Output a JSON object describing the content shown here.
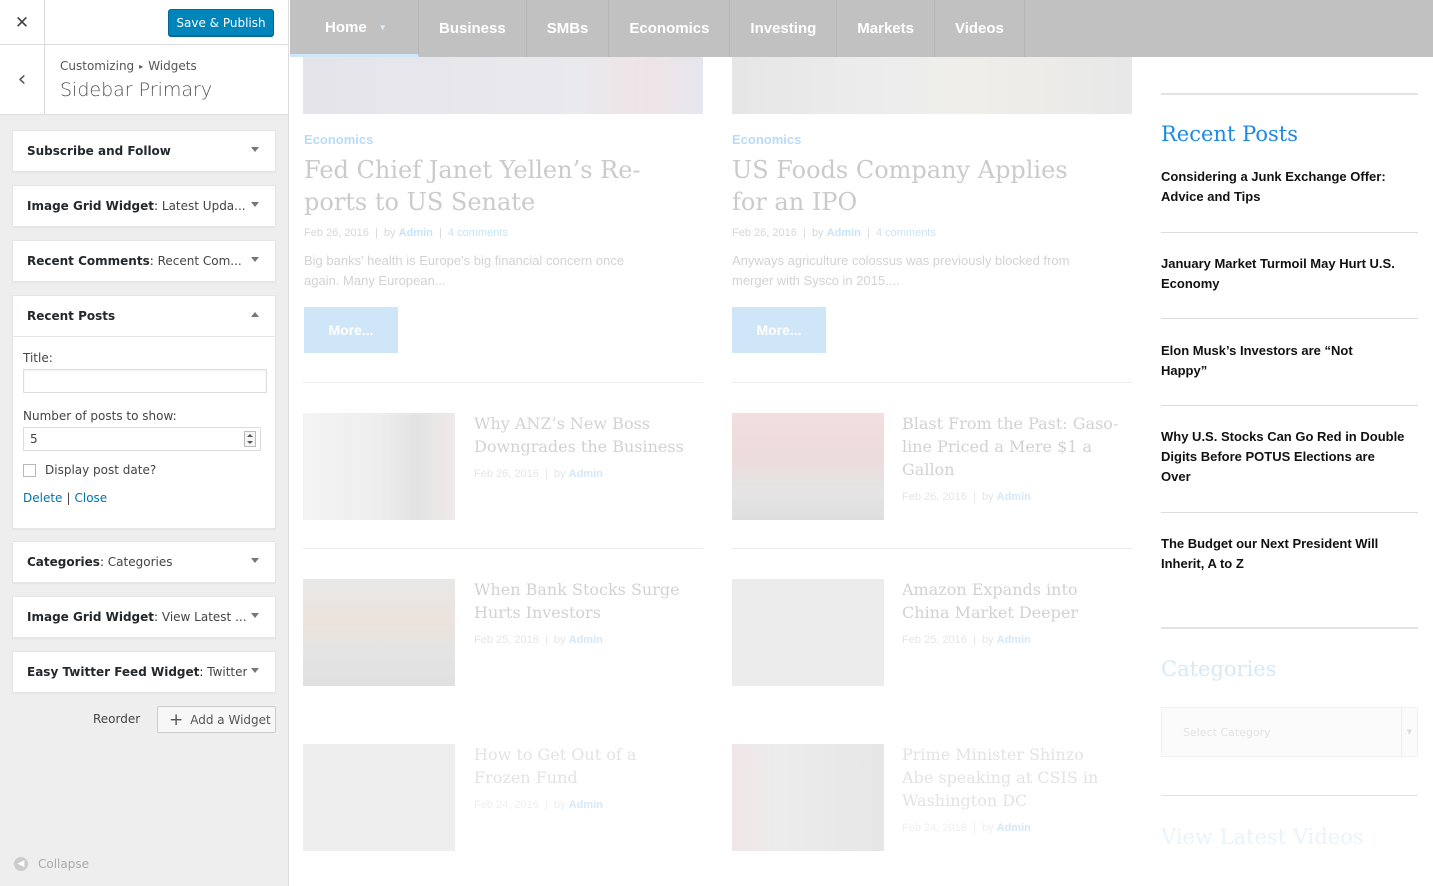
{
  "customizer": {
    "close_icon": "close-icon",
    "publish_label": "Save & Publish",
    "breadcrumb": [
      "Customizing",
      "Widgets"
    ],
    "section_title": "Sidebar Primary",
    "widgets": [
      {
        "name": "Subscribe and Follow",
        "sub": ""
      },
      {
        "name": "Image Grid Widget",
        "sub": "Latest Upda..."
      },
      {
        "name": "Recent Comments",
        "sub": "Recent Com..."
      },
      {
        "name": "Recent Posts",
        "sub": ""
      },
      {
        "name": "Categories",
        "sub": "Categories"
      },
      {
        "name": "Image Grid Widget",
        "sub": "View Latest ..."
      },
      {
        "name": "Easy Twitter Feed Widget",
        "sub": "Twitter"
      }
    ],
    "form": {
      "title_label": "Title:",
      "title_value": "",
      "count_label": "Number of posts to show:",
      "count_value": "5",
      "date_label": "Display post date?",
      "delete": "Delete",
      "separator": "|",
      "close": "Close"
    },
    "reorder": "Reorder",
    "add_widget": "Add a Widget",
    "collapse": "Collapse"
  },
  "site": {
    "nav": [
      "Home",
      "Business",
      "SMBs",
      "Economics",
      "Investing",
      "Markets",
      "Videos"
    ],
    "featured": [
      {
        "category": "Economics",
        "title_lines": [
          "Fed Chief Janet Yellen’s Re-",
          "ports to US Senate"
        ],
        "date": "Feb 26, 2016",
        "by": "by",
        "author": "Admin",
        "comments": "4 comments",
        "excerpt_lines": [
          "Big banks' health is Europe's big financial concern once",
          "again. Many European..."
        ],
        "more": "More..."
      },
      {
        "category": "Economics",
        "title_lines": [
          "US Foods Company Applies",
          "for an IPO"
        ],
        "date": "Feb 26, 2016",
        "by": "by",
        "author": "Admin",
        "comments": "4 comments",
        "excerpt_lines": [
          "Anyways agriculture colossus was previously blocked from",
          "merger with Sysco in 2015...."
        ],
        "more": "More..."
      }
    ],
    "small_posts": [
      {
        "title_lines": [
          "Why ANZ’s New Boss",
          "Downgrades the Business"
        ],
        "date": "Feb 26, 2016",
        "by": "by",
        "author": "Admin"
      },
      {
        "title_lines": [
          "Blast From the Past: Gaso-",
          "line Priced a Mere $1 a",
          "Gallon"
        ],
        "date": "Feb 26, 2016",
        "by": "by",
        "author": "Admin"
      },
      {
        "title_lines": [
          "When Bank Stocks Surge",
          "Hurts Investors"
        ],
        "date": "Feb 25, 2016",
        "by": "by",
        "author": "Admin"
      },
      {
        "title_lines": [
          "Amazon Expands into",
          "China Market Deeper"
        ],
        "date": "Feb 25, 2016",
        "by": "by",
        "author": "Admin"
      },
      {
        "title_lines": [
          "How to Get Out of a",
          "Frozen Fund"
        ],
        "date": "Feb 24, 2016",
        "by": "by",
        "author": "Admin"
      },
      {
        "title_lines": [
          "Prime Minister Shinzo",
          "Abe speaking at CSIS in",
          "Washington DC"
        ],
        "date": "Feb 24, 2016",
        "by": "by",
        "author": "Admin"
      }
    ],
    "sidebar": {
      "recent_posts_title": "Recent Posts",
      "recent_posts": [
        [
          "Considering a Junk Exchange Offer:",
          "Advice and Tips"
        ],
        [
          "January Market Turmoil May Hurt U.S.",
          "Economy"
        ],
        [
          "Elon Musk’s Investors are “Not",
          "Happy”"
        ],
        [
          "Why U.S. Stocks Can Go Red in Double",
          "Digits Before POTUS Elections are",
          "Over"
        ],
        [
          "The Budget our Next President Will",
          "Inherit, A to Z"
        ]
      ],
      "categories_title": "Categories",
      "select_placeholder": "Select Category",
      "videos_title": "View Latest Videos"
    }
  }
}
